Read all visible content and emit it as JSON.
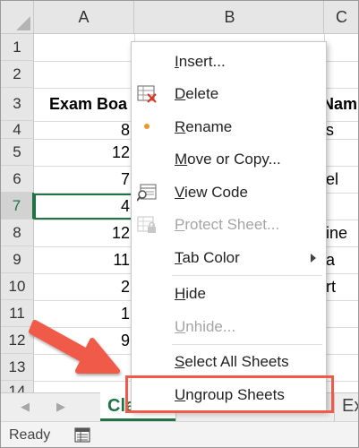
{
  "columns": [
    "A",
    "B",
    "C"
  ],
  "rows": [
    "1",
    "2",
    "3",
    "4",
    "5",
    "6",
    "7",
    "8",
    "9",
    "10",
    "11",
    "12",
    "13",
    "14"
  ],
  "active_row": "7",
  "cells": {
    "a3": "Exam Boa",
    "a4": "8",
    "a5": "12",
    "a6": "7",
    "a7": "4",
    "a8": "12",
    "a9": "11",
    "a10": "2",
    "a11": "1",
    "a12": "9",
    "c3": "Nam",
    "c4": "s",
    "c6": "el",
    "c8": "ine",
    "c9": "a",
    "c10": "rt"
  },
  "context_menu": {
    "items": [
      {
        "label": "Insert...",
        "ul": "I",
        "rest": "nsert...",
        "enabled": true,
        "icon": "none"
      },
      {
        "label": "Delete",
        "ul": "D",
        "rest": "elete",
        "enabled": true,
        "icon": "delete-sheet-icon"
      },
      {
        "label": "Rename",
        "ul": "R",
        "rest": "ename",
        "enabled": true,
        "icon": "rename-dot-icon"
      },
      {
        "label": "Move or Copy...",
        "ul": "M",
        "rest": "ove or Copy...",
        "enabled": true,
        "icon": "none"
      },
      {
        "label": "View Code",
        "ul": "V",
        "rest": "iew Code",
        "enabled": true,
        "icon": "view-code-icon"
      },
      {
        "label": "Protect Sheet...",
        "ul": "P",
        "rest": "rotect Sheet...",
        "enabled": false,
        "icon": "protect-sheet-icon"
      },
      {
        "label": "Tab Color",
        "ul": "T",
        "rest": "ab Color",
        "enabled": true,
        "icon": "none",
        "submenu": true
      },
      {
        "label": "Hide",
        "ul": "H",
        "rest": "ide",
        "enabled": true,
        "icon": "none"
      },
      {
        "label": "Unhide...",
        "ul": "U",
        "rest": "nhide...",
        "enabled": false,
        "icon": "none"
      },
      {
        "label": "Select All Sheets",
        "ul": "S",
        "rest": "elect All Sheets",
        "enabled": true,
        "icon": "none"
      },
      {
        "label": "Ungroup Sheets",
        "ul": "U",
        "rest": "ngroup Sheets",
        "enabled": true,
        "icon": "none",
        "highlighted": true
      }
    ]
  },
  "sheet_tabs": [
    {
      "label": "Cla",
      "active": true
    },
    {
      "label": "Ex",
      "active": false
    }
  ],
  "status": {
    "text": "Ready"
  },
  "colors": {
    "accent": "#217346",
    "annotation": "#f05a48",
    "disabled_text": "#a5a5a5"
  }
}
